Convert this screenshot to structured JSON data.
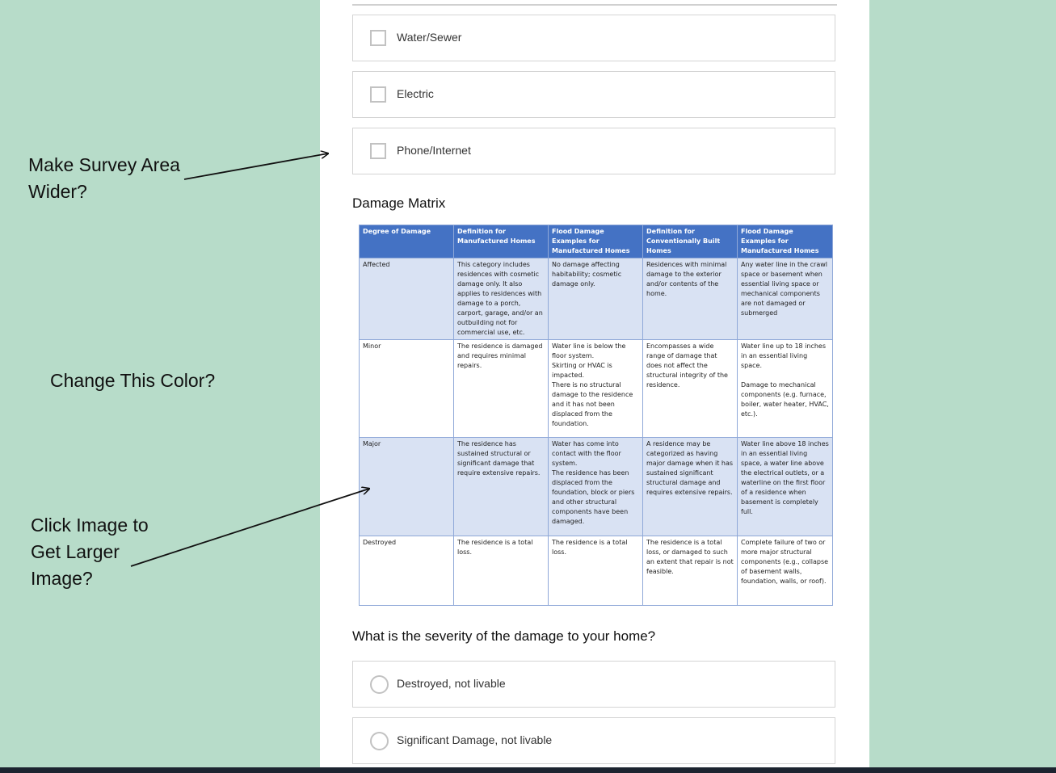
{
  "utilities": {
    "options": [
      {
        "label": "Water/Sewer"
      },
      {
        "label": "Electric"
      },
      {
        "label": "Phone/Internet"
      }
    ]
  },
  "matrix": {
    "title": "Damage Matrix",
    "headers": [
      "Degree of Damage",
      "Definition for Manufactured Homes",
      "Flood Damage Examples for Manufactured Homes",
      "Definition for Conventionally Built Homes",
      "Flood Damage Examples for Manufactured Homes"
    ],
    "rows": [
      {
        "degree": "Affected",
        "def_manufactured": "This category includes residences with cosmetic damage only. It also applies to residences with damage to a porch, carport, garage, and/or an outbuilding not for commercial use, etc.",
        "flood_manufactured": "No damage affecting habitability; cosmetic damage only.",
        "def_conventional": "Residences with minimal damage to the exterior and/or contents of the home.",
        "flood_examples": "Any water line in the crawl space or basement when essential living space or mechanical components are not damaged or submerged"
      },
      {
        "degree": "Minor",
        "def_manufactured": "The residence is damaged and requires minimal repairs.",
        "flood_manufactured": "Water line is below the floor system.\nSkirting or HVAC is impacted.\nThere is no structural damage to the residence and it has not been displaced from the foundation.",
        "def_conventional": "Encompasses a wide range of damage that does not affect the structural integrity of the residence.",
        "flood_examples": "Water line up to 18 inches in an essential living space.\n\nDamage to mechanical components (e.g. furnace, boiler, water heater, HVAC, etc.)."
      },
      {
        "degree": "Major",
        "def_manufactured": "The residence has sustained structural or significant damage that require extensive repairs.",
        "flood_manufactured": "Water has come into contact with the floor system.\nThe residence has been displaced from the foundation, block or piers and other structural components have been damaged.",
        "def_conventional": "A residence may be categorized as having major damage when it has sustained significant structural damage and requires extensive repairs.",
        "flood_examples": "Water line above 18 inches in an essential living space, a water line above the electrical outlets, or a waterline on the first floor of a residence when basement is completely full."
      },
      {
        "degree": "Destroyed",
        "def_manufactured": "The residence is a total loss.",
        "flood_manufactured": "The residence is a total loss.",
        "def_conventional": "The residence is a total loss, or damaged to such an extent that repair is not feasible.",
        "flood_examples": "Complete failure of two or more major structural components (e.g., collapse of basement walls, foundation, walls, or roof)."
      }
    ]
  },
  "severity": {
    "question": "What is the severity of the damage to your home?",
    "options": [
      {
        "label": "Destroyed, not livable"
      },
      {
        "label": "Significant Damage, not livable"
      }
    ]
  },
  "annotations": {
    "wider": "Make Survey Area\nWider?",
    "color": "Change This Color?",
    "larger": "Click Image to\nGet Larger\nImage?"
  }
}
